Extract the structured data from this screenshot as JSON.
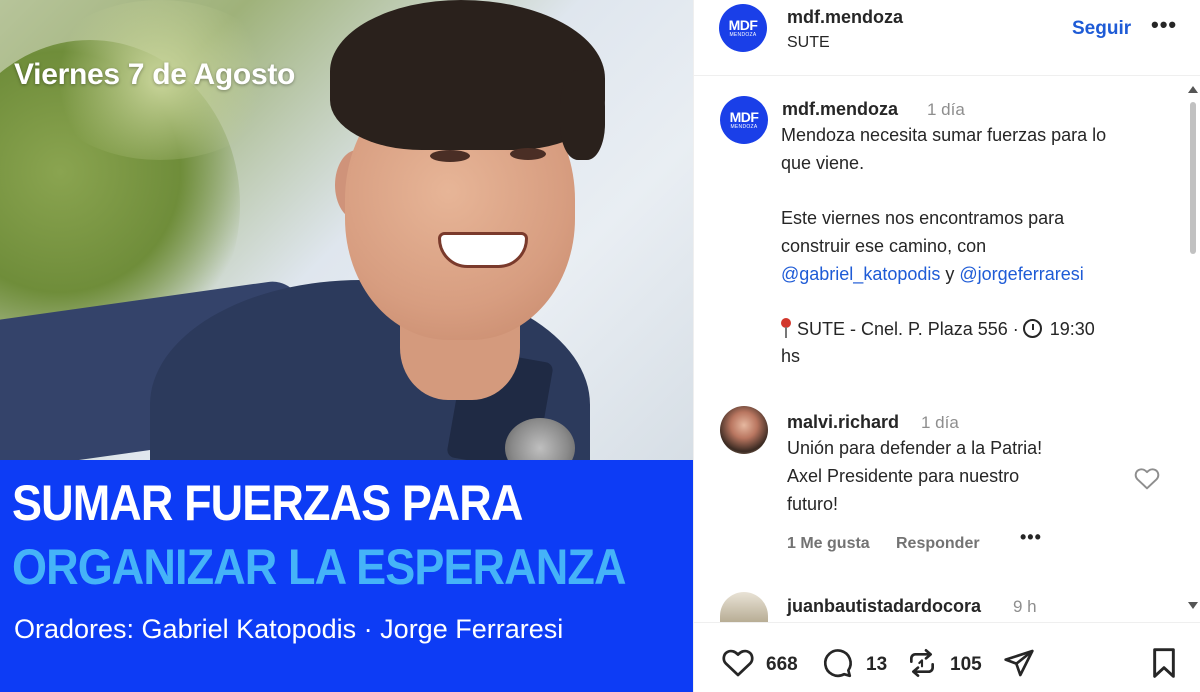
{
  "post_image": {
    "date_text": "Viernes 7 de Agosto",
    "headline_line1": "SUMAR FUERZAS PARA",
    "headline_line2": "ORGANIZAR LA ESPERANZA",
    "speakers": "Oradores: Gabriel Katopodis · Jorge Ferraresi",
    "banner_color": "#0d3cf5",
    "headline_accent_color": "#45b3f8"
  },
  "header": {
    "avatar_text": "MDF",
    "avatar_subtext": "MENDOZA",
    "username": "mdf.mendoza",
    "location": "SUTE",
    "follow_label": "Seguir",
    "more_label": "•••"
  },
  "caption": {
    "username": "mdf.mendoza",
    "time": "1 día",
    "line1": "Mendoza necesita sumar fuerzas para lo",
    "line2": "que viene.",
    "line3": "Este viernes nos encontramos para",
    "line4": "construir ese camino, con",
    "mention1": "@gabriel_katopodis",
    "and_text": " y ",
    "mention2": "@jorgeferraresi",
    "location_line": "SUTE - Cnel. P. Plaza 556 ·",
    "time_line": "19:30",
    "time_suffix": "hs"
  },
  "comments": [
    {
      "username": "malvi.richard",
      "time": "1 día",
      "line1": "Unión para defender a la Patria!",
      "line2": "Axel Presidente para nuestro",
      "line3": "futuro!",
      "likes_label": "1 Me gusta",
      "reply_label": "Responder",
      "more_label": "•••"
    },
    {
      "username": "juanbautistadardocora",
      "time": "9 h"
    }
  ],
  "actions": {
    "likes": "668",
    "comments": "13",
    "reposts": "105"
  },
  "colors": {
    "link": "#1e5bd6",
    "muted": "#8e8e8e",
    "brand": "#1a3fe8"
  }
}
